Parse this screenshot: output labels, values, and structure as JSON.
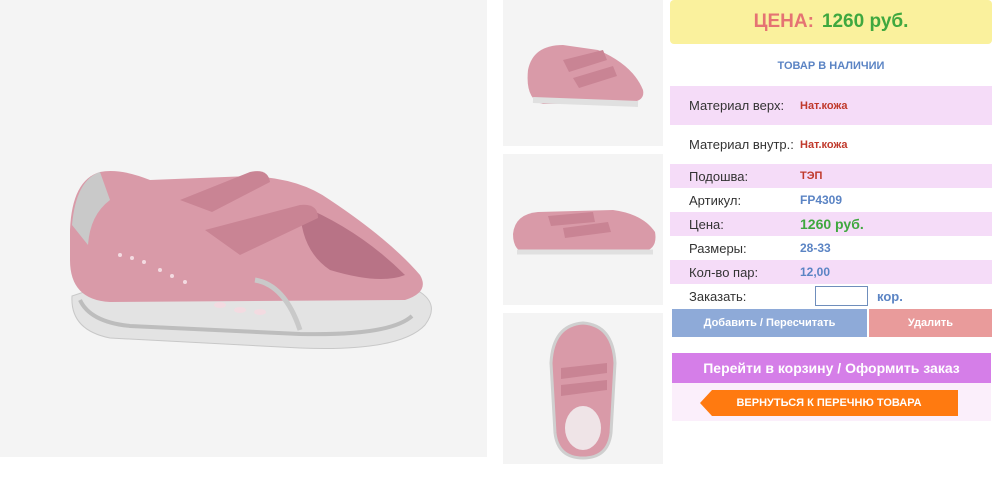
{
  "product": {
    "main_image_alt": "pink sneaker",
    "thumbnails": [
      "side-view",
      "profile-view",
      "top-view"
    ]
  },
  "price_banner": {
    "label": "ЦЕНА:",
    "value": "1260 руб."
  },
  "stock_status": "ТОВАР В НАЛИЧИИ",
  "attributes": [
    {
      "key": "Материал верх:",
      "value": "Нат.кожа"
    },
    {
      "key": "Материал внутр.:",
      "value": "Нат.кожа"
    },
    {
      "key": "Подошва:",
      "value": "ТЭП"
    },
    {
      "key": "Артикул:",
      "value": "FP4309"
    },
    {
      "key": "Цена:",
      "value": "1260 руб."
    },
    {
      "key": "Размеры:",
      "value": "28-33"
    },
    {
      "key": "Кол-во пар:",
      "value": "12,00"
    }
  ],
  "order": {
    "label": "Заказать:",
    "quantity_value": "",
    "unit": "кор."
  },
  "buttons": {
    "add": "Добавить / Пересчитать",
    "delete": "Удалить",
    "cart": "Перейти в корзину / Оформить заказ",
    "back": "ВЕРНУТЬСЯ К ПЕРЕЧНЮ ТОВАРА"
  },
  "colors": {
    "price_banner_bg": "#faf19d",
    "price_label": "#e57373",
    "price_value": "#3fa83f",
    "row_highlight": "#f5dcf8",
    "add_button": "#8eaad8",
    "delete_button": "#e99b9b",
    "cart_button": "#d57ee8",
    "back_button": "#ff7a10"
  }
}
